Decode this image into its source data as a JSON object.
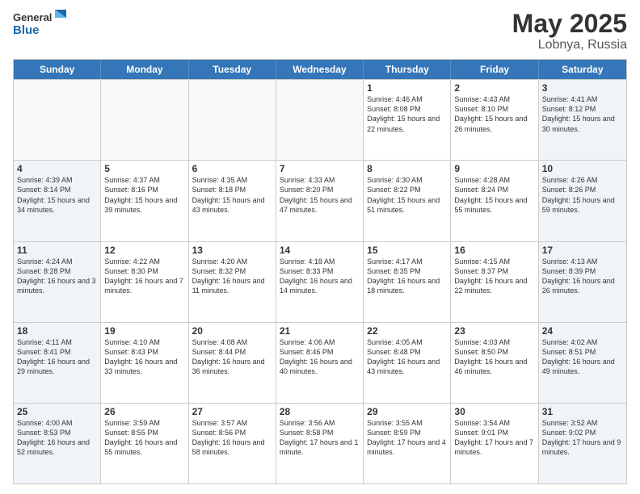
{
  "header": {
    "logo_general": "General",
    "logo_blue": "Blue",
    "month_title": "May 2025",
    "location": "Lobnya, Russia"
  },
  "day_headers": [
    "Sunday",
    "Monday",
    "Tuesday",
    "Wednesday",
    "Thursday",
    "Friday",
    "Saturday"
  ],
  "weeks": [
    {
      "days": [
        {
          "num": "",
          "info": "",
          "empty": true
        },
        {
          "num": "",
          "info": "",
          "empty": true
        },
        {
          "num": "",
          "info": "",
          "empty": true
        },
        {
          "num": "",
          "info": "",
          "empty": true
        },
        {
          "num": "1",
          "info": "Sunrise: 4:46 AM\nSunset: 8:08 PM\nDaylight: 15 hours\nand 22 minutes."
        },
        {
          "num": "2",
          "info": "Sunrise: 4:43 AM\nSunset: 8:10 PM\nDaylight: 15 hours\nand 26 minutes."
        },
        {
          "num": "3",
          "info": "Sunrise: 4:41 AM\nSunset: 8:12 PM\nDaylight: 15 hours\nand 30 minutes."
        }
      ]
    },
    {
      "days": [
        {
          "num": "4",
          "info": "Sunrise: 4:39 AM\nSunset: 8:14 PM\nDaylight: 15 hours\nand 34 minutes."
        },
        {
          "num": "5",
          "info": "Sunrise: 4:37 AM\nSunset: 8:16 PM\nDaylight: 15 hours\nand 39 minutes."
        },
        {
          "num": "6",
          "info": "Sunrise: 4:35 AM\nSunset: 8:18 PM\nDaylight: 15 hours\nand 43 minutes."
        },
        {
          "num": "7",
          "info": "Sunrise: 4:33 AM\nSunset: 8:20 PM\nDaylight: 15 hours\nand 47 minutes."
        },
        {
          "num": "8",
          "info": "Sunrise: 4:30 AM\nSunset: 8:22 PM\nDaylight: 15 hours\nand 51 minutes."
        },
        {
          "num": "9",
          "info": "Sunrise: 4:28 AM\nSunset: 8:24 PM\nDaylight: 15 hours\nand 55 minutes."
        },
        {
          "num": "10",
          "info": "Sunrise: 4:26 AM\nSunset: 8:26 PM\nDaylight: 15 hours\nand 59 minutes."
        }
      ]
    },
    {
      "days": [
        {
          "num": "11",
          "info": "Sunrise: 4:24 AM\nSunset: 8:28 PM\nDaylight: 16 hours\nand 3 minutes."
        },
        {
          "num": "12",
          "info": "Sunrise: 4:22 AM\nSunset: 8:30 PM\nDaylight: 16 hours\nand 7 minutes."
        },
        {
          "num": "13",
          "info": "Sunrise: 4:20 AM\nSunset: 8:32 PM\nDaylight: 16 hours\nand 11 minutes."
        },
        {
          "num": "14",
          "info": "Sunrise: 4:18 AM\nSunset: 8:33 PM\nDaylight: 16 hours\nand 14 minutes."
        },
        {
          "num": "15",
          "info": "Sunrise: 4:17 AM\nSunset: 8:35 PM\nDaylight: 16 hours\nand 18 minutes."
        },
        {
          "num": "16",
          "info": "Sunrise: 4:15 AM\nSunset: 8:37 PM\nDaylight: 16 hours\nand 22 minutes."
        },
        {
          "num": "17",
          "info": "Sunrise: 4:13 AM\nSunset: 8:39 PM\nDaylight: 16 hours\nand 26 minutes."
        }
      ]
    },
    {
      "days": [
        {
          "num": "18",
          "info": "Sunrise: 4:11 AM\nSunset: 8:41 PM\nDaylight: 16 hours\nand 29 minutes."
        },
        {
          "num": "19",
          "info": "Sunrise: 4:10 AM\nSunset: 8:43 PM\nDaylight: 16 hours\nand 33 minutes."
        },
        {
          "num": "20",
          "info": "Sunrise: 4:08 AM\nSunset: 8:44 PM\nDaylight: 16 hours\nand 36 minutes."
        },
        {
          "num": "21",
          "info": "Sunrise: 4:06 AM\nSunset: 8:46 PM\nDaylight: 16 hours\nand 40 minutes."
        },
        {
          "num": "22",
          "info": "Sunrise: 4:05 AM\nSunset: 8:48 PM\nDaylight: 16 hours\nand 43 minutes."
        },
        {
          "num": "23",
          "info": "Sunrise: 4:03 AM\nSunset: 8:50 PM\nDaylight: 16 hours\nand 46 minutes."
        },
        {
          "num": "24",
          "info": "Sunrise: 4:02 AM\nSunset: 8:51 PM\nDaylight: 16 hours\nand 49 minutes."
        }
      ]
    },
    {
      "days": [
        {
          "num": "25",
          "info": "Sunrise: 4:00 AM\nSunset: 8:53 PM\nDaylight: 16 hours\nand 52 minutes."
        },
        {
          "num": "26",
          "info": "Sunrise: 3:59 AM\nSunset: 8:55 PM\nDaylight: 16 hours\nand 55 minutes."
        },
        {
          "num": "27",
          "info": "Sunrise: 3:57 AM\nSunset: 8:56 PM\nDaylight: 16 hours\nand 58 minutes."
        },
        {
          "num": "28",
          "info": "Sunrise: 3:56 AM\nSunset: 8:58 PM\nDaylight: 17 hours\nand 1 minute."
        },
        {
          "num": "29",
          "info": "Sunrise: 3:55 AM\nSunset: 8:59 PM\nDaylight: 17 hours\nand 4 minutes."
        },
        {
          "num": "30",
          "info": "Sunrise: 3:54 AM\nSunset: 9:01 PM\nDaylight: 17 hours\nand 7 minutes."
        },
        {
          "num": "31",
          "info": "Sunrise: 3:52 AM\nSunset: 9:02 PM\nDaylight: 17 hours\nand 9 minutes."
        }
      ]
    }
  ]
}
